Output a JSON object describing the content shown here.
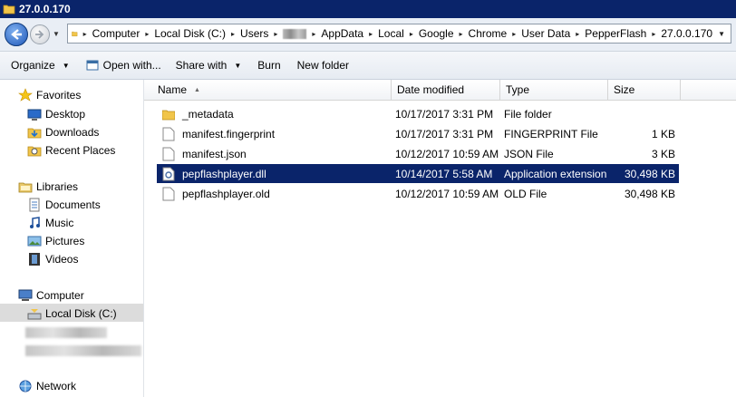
{
  "window": {
    "title": "27.0.0.170"
  },
  "address": {
    "segments": [
      "Computer",
      "Local Disk (C:)",
      "Users",
      "",
      "AppData",
      "Local",
      "Google",
      "Chrome",
      "User Data",
      "PepperFlash",
      "27.0.0.170"
    ]
  },
  "toolbar": {
    "organize": "Organize",
    "open_with": "Open with...",
    "share_with": "Share with",
    "burn": "Burn",
    "new_folder": "New folder"
  },
  "sidebar": {
    "favorites": "Favorites",
    "desktop": "Desktop",
    "downloads": "Downloads",
    "recent_places": "Recent Places",
    "libraries": "Libraries",
    "documents": "Documents",
    "music": "Music",
    "pictures": "Pictures",
    "videos": "Videos",
    "computer": "Computer",
    "local_disk": "Local Disk (C:)",
    "network": "Network"
  },
  "columns": {
    "name": "Name",
    "date": "Date modified",
    "type": "Type",
    "size": "Size"
  },
  "files": [
    {
      "name": "_metadata",
      "date": "10/17/2017 3:31 PM",
      "type": "File folder",
      "size": "",
      "icon": "folder-icon"
    },
    {
      "name": "manifest.fingerprint",
      "date": "10/17/2017 3:31 PM",
      "type": "FINGERPRINT File",
      "size": "1 KB",
      "icon": "file-icon"
    },
    {
      "name": "manifest.json",
      "date": "10/12/2017 10:59 AM",
      "type": "JSON File",
      "size": "3 KB",
      "icon": "file-icon"
    },
    {
      "name": "pepflashplayer.dll",
      "date": "10/14/2017 5:58 AM",
      "type": "Application extension",
      "size": "30,498 KB",
      "icon": "dll-icon",
      "selected": true
    },
    {
      "name": "pepflashplayer.old",
      "date": "10/12/2017 10:59 AM",
      "type": "OLD File",
      "size": "30,498 KB",
      "icon": "file-icon"
    }
  ],
  "colors": {
    "titlebar": "#0a246a",
    "selection": "#0a246a"
  }
}
